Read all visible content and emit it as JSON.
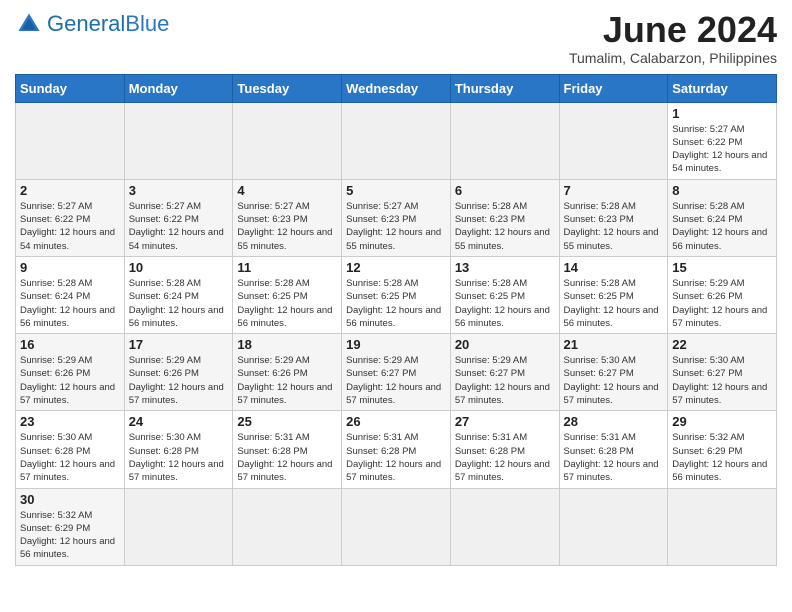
{
  "header": {
    "logo_general": "General",
    "logo_blue": "Blue",
    "month_year": "June 2024",
    "location": "Tumalim, Calabarzon, Philippines"
  },
  "days_of_week": [
    "Sunday",
    "Monday",
    "Tuesday",
    "Wednesday",
    "Thursday",
    "Friday",
    "Saturday"
  ],
  "weeks": [
    [
      {
        "day": "",
        "info": ""
      },
      {
        "day": "",
        "info": ""
      },
      {
        "day": "",
        "info": ""
      },
      {
        "day": "",
        "info": ""
      },
      {
        "day": "",
        "info": ""
      },
      {
        "day": "",
        "info": ""
      },
      {
        "day": "1",
        "info": "Sunrise: 5:27 AM\nSunset: 6:22 PM\nDaylight: 12 hours and 54 minutes."
      }
    ],
    [
      {
        "day": "2",
        "info": "Sunrise: 5:27 AM\nSunset: 6:22 PM\nDaylight: 12 hours and 54 minutes."
      },
      {
        "day": "3",
        "info": "Sunrise: 5:27 AM\nSunset: 6:22 PM\nDaylight: 12 hours and 54 minutes."
      },
      {
        "day": "4",
        "info": "Sunrise: 5:27 AM\nSunset: 6:23 PM\nDaylight: 12 hours and 55 minutes."
      },
      {
        "day": "5",
        "info": "Sunrise: 5:27 AM\nSunset: 6:23 PM\nDaylight: 12 hours and 55 minutes."
      },
      {
        "day": "6",
        "info": "Sunrise: 5:28 AM\nSunset: 6:23 PM\nDaylight: 12 hours and 55 minutes."
      },
      {
        "day": "7",
        "info": "Sunrise: 5:28 AM\nSunset: 6:23 PM\nDaylight: 12 hours and 55 minutes."
      },
      {
        "day": "8",
        "info": "Sunrise: 5:28 AM\nSunset: 6:24 PM\nDaylight: 12 hours and 56 minutes."
      }
    ],
    [
      {
        "day": "9",
        "info": "Sunrise: 5:28 AM\nSunset: 6:24 PM\nDaylight: 12 hours and 56 minutes."
      },
      {
        "day": "10",
        "info": "Sunrise: 5:28 AM\nSunset: 6:24 PM\nDaylight: 12 hours and 56 minutes."
      },
      {
        "day": "11",
        "info": "Sunrise: 5:28 AM\nSunset: 6:25 PM\nDaylight: 12 hours and 56 minutes."
      },
      {
        "day": "12",
        "info": "Sunrise: 5:28 AM\nSunset: 6:25 PM\nDaylight: 12 hours and 56 minutes."
      },
      {
        "day": "13",
        "info": "Sunrise: 5:28 AM\nSunset: 6:25 PM\nDaylight: 12 hours and 56 minutes."
      },
      {
        "day": "14",
        "info": "Sunrise: 5:28 AM\nSunset: 6:25 PM\nDaylight: 12 hours and 56 minutes."
      },
      {
        "day": "15",
        "info": "Sunrise: 5:29 AM\nSunset: 6:26 PM\nDaylight: 12 hours and 57 minutes."
      }
    ],
    [
      {
        "day": "16",
        "info": "Sunrise: 5:29 AM\nSunset: 6:26 PM\nDaylight: 12 hours and 57 minutes."
      },
      {
        "day": "17",
        "info": "Sunrise: 5:29 AM\nSunset: 6:26 PM\nDaylight: 12 hours and 57 minutes."
      },
      {
        "day": "18",
        "info": "Sunrise: 5:29 AM\nSunset: 6:26 PM\nDaylight: 12 hours and 57 minutes."
      },
      {
        "day": "19",
        "info": "Sunrise: 5:29 AM\nSunset: 6:27 PM\nDaylight: 12 hours and 57 minutes."
      },
      {
        "day": "20",
        "info": "Sunrise: 5:29 AM\nSunset: 6:27 PM\nDaylight: 12 hours and 57 minutes."
      },
      {
        "day": "21",
        "info": "Sunrise: 5:30 AM\nSunset: 6:27 PM\nDaylight: 12 hours and 57 minutes."
      },
      {
        "day": "22",
        "info": "Sunrise: 5:30 AM\nSunset: 6:27 PM\nDaylight: 12 hours and 57 minutes."
      }
    ],
    [
      {
        "day": "23",
        "info": "Sunrise: 5:30 AM\nSunset: 6:28 PM\nDaylight: 12 hours and 57 minutes."
      },
      {
        "day": "24",
        "info": "Sunrise: 5:30 AM\nSunset: 6:28 PM\nDaylight: 12 hours and 57 minutes."
      },
      {
        "day": "25",
        "info": "Sunrise: 5:31 AM\nSunset: 6:28 PM\nDaylight: 12 hours and 57 minutes."
      },
      {
        "day": "26",
        "info": "Sunrise: 5:31 AM\nSunset: 6:28 PM\nDaylight: 12 hours and 57 minutes."
      },
      {
        "day": "27",
        "info": "Sunrise: 5:31 AM\nSunset: 6:28 PM\nDaylight: 12 hours and 57 minutes."
      },
      {
        "day": "28",
        "info": "Sunrise: 5:31 AM\nSunset: 6:28 PM\nDaylight: 12 hours and 57 minutes."
      },
      {
        "day": "29",
        "info": "Sunrise: 5:32 AM\nSunset: 6:29 PM\nDaylight: 12 hours and 56 minutes."
      }
    ],
    [
      {
        "day": "30",
        "info": "Sunrise: 5:32 AM\nSunset: 6:29 PM\nDaylight: 12 hours and 56 minutes."
      },
      {
        "day": "",
        "info": ""
      },
      {
        "day": "",
        "info": ""
      },
      {
        "day": "",
        "info": ""
      },
      {
        "day": "",
        "info": ""
      },
      {
        "day": "",
        "info": ""
      },
      {
        "day": "",
        "info": ""
      }
    ]
  ]
}
